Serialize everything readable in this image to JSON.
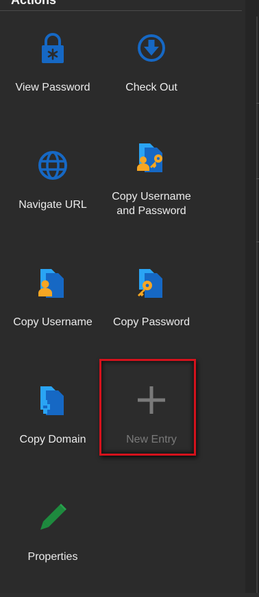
{
  "panel": {
    "title": "Actions"
  },
  "actions": [
    {
      "label": "View Password"
    },
    {
      "label": "Check Out"
    },
    {
      "label": "Navigate URL"
    },
    {
      "label": "Copy Username and Password"
    },
    {
      "label": "Copy Username"
    },
    {
      "label": "Copy Password"
    },
    {
      "label": "Copy Domain"
    },
    {
      "label": "New Entry"
    },
    {
      "label": "Properties"
    }
  ],
  "colors": {
    "icon_blue": "#1668c4",
    "icon_light_blue": "#2aa4f4",
    "icon_yellow": "#f6a623",
    "icon_green": "#1e8a3e",
    "highlight_red": "#d4121c",
    "disabled_gray": "#7a7a7a"
  },
  "icons": {
    "view_password": "padlock-asterisk-icon",
    "check_out": "circle-down-arrow-icon",
    "navigate_url": "globe-icon",
    "copy_username_password": "copy-user-key-icon",
    "copy_username": "copy-user-icon",
    "copy_password": "copy-key-icon",
    "copy_domain": "copy-domain-icon",
    "new_entry": "plus-icon",
    "properties": "pencil-icon"
  }
}
